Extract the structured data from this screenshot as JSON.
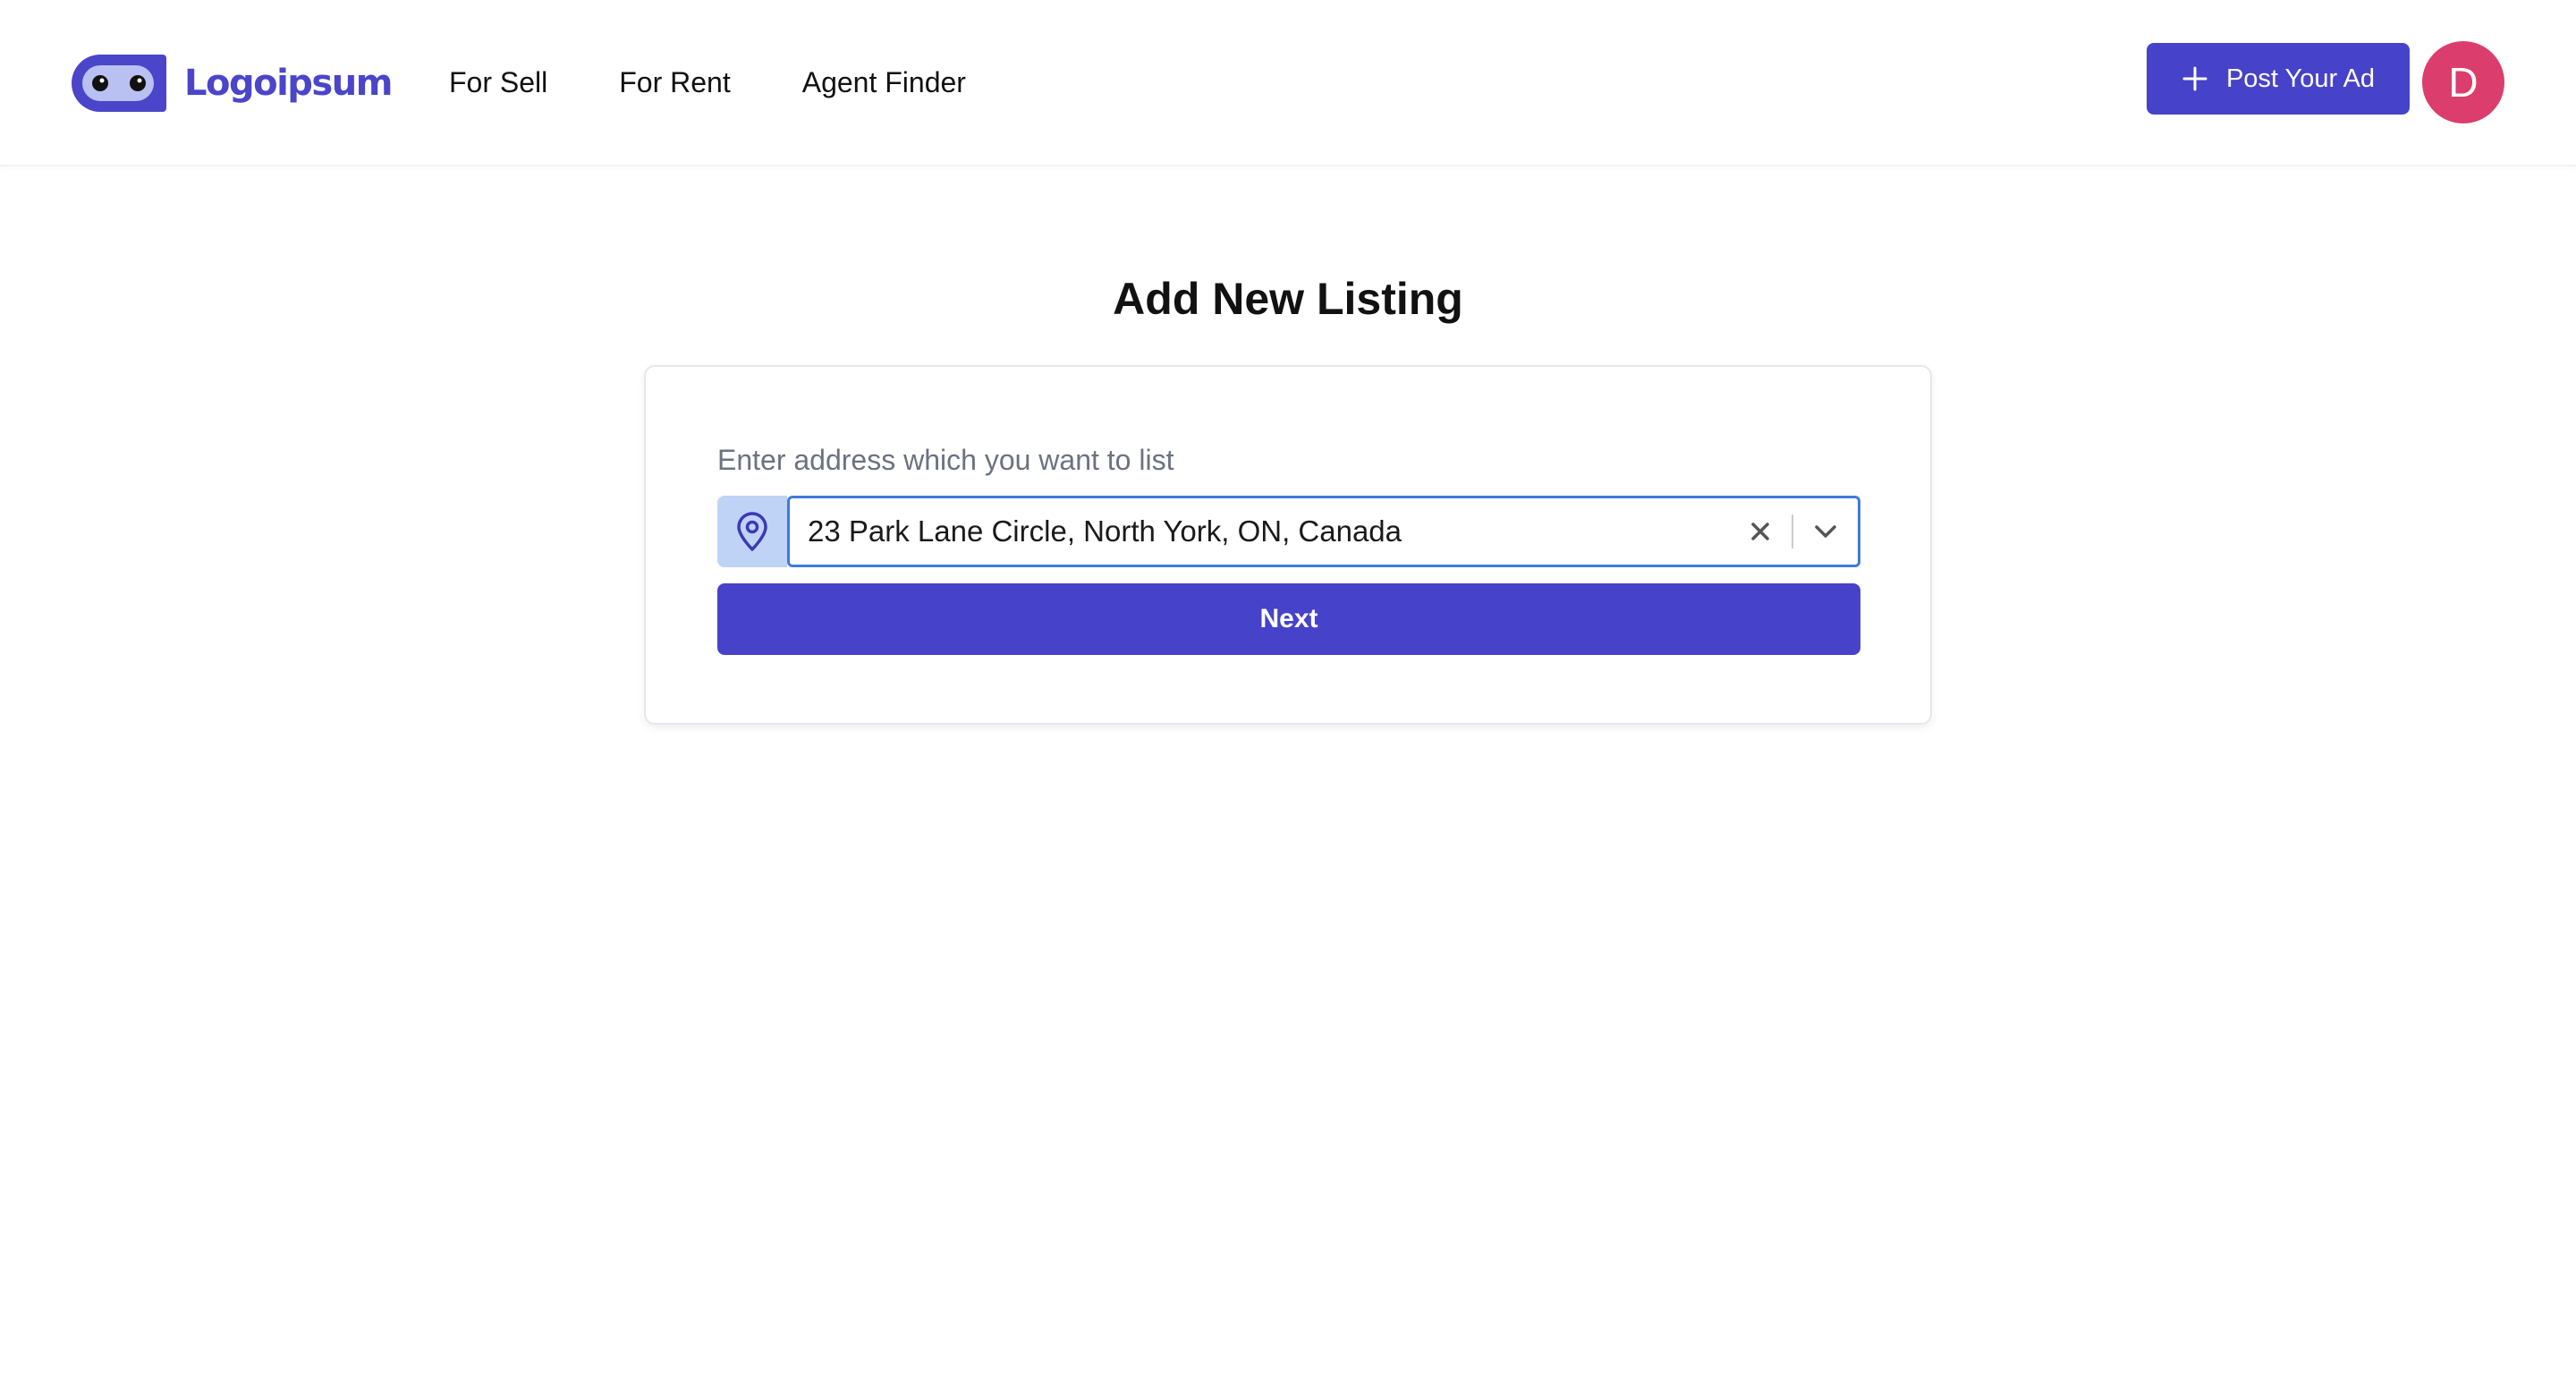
{
  "header": {
    "logo_text": "Logoipsum",
    "logo_icon": "logo-mark-icon",
    "nav": [
      {
        "label": "For Sell"
      },
      {
        "label": "For Rent"
      },
      {
        "label": "Agent Finder"
      }
    ],
    "post_button": {
      "label": "Post Your Ad",
      "icon": "plus-icon"
    },
    "avatar": {
      "initial": "D",
      "color": "#db3d6d"
    }
  },
  "main": {
    "title": "Add New Listing",
    "form": {
      "label": "Enter address which you want to list",
      "address": {
        "value": "23 Park Lane Circle, North York, ON, Canada",
        "prefix_icon": "location-pin-icon",
        "clear_icon": "close-icon",
        "dropdown_icon": "chevron-down-icon"
      },
      "submit_label": "Next"
    }
  },
  "colors": {
    "brand": "#4642c9",
    "addon_bg": "#bfd3f7",
    "focus_border": "#3f7ae0",
    "avatar_bg": "#db3d6d",
    "muted_text": "#6b7280"
  }
}
